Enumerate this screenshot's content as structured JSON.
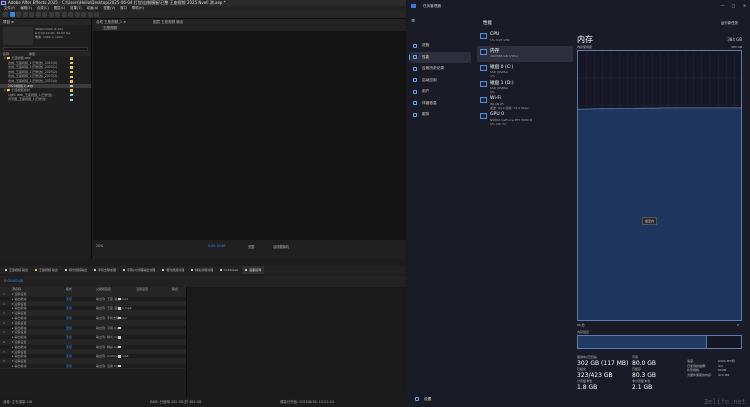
{
  "ae": {
    "title": "Adobe After Effects 2025 - C:\\Users\\Hello\\Desktop\\2025-06-04 打包\\自制模板\\已整 王座视频 2025 Nvell 测.aep *",
    "menu": [
      "文件(F)",
      "编辑(E)",
      "合成(C)",
      "图层(L)",
      "效果(T)",
      "动画(A)",
      "视图(V)",
      "窗口",
      "帮助(H)"
    ],
    "project_panel": {
      "tab": "项目 ≡",
      "thumb_info": "3840×2160 (1.00)\nΔ 0:00:10:00, 30.00 fps\n像素: 1080 × 1920",
      "columns": [
        "名称",
        "类型"
      ],
      "rows": [
        {
          "label": "▾ 📁 王座视频.aep",
          "kind": "folder",
          "color": "#e8c34a"
        },
        {
          "label": "合成_王座视频_1(已修改)_2025(0)",
          "kind": "item",
          "color": "#e8c34a"
        },
        {
          "label": "合成_王座视频_1(已修改)_2025(1)",
          "kind": "item",
          "color": "#e8c34a"
        },
        {
          "label": "合成_王座视频_1(已修改)_2025(2)",
          "kind": "item",
          "color": "#e8c34a"
        },
        {
          "label": "合成_王座视频_1(已修改)_2025(3)",
          "kind": "item",
          "color": "#e8c34a"
        },
        {
          "label": "合成_王座视频_1(已修改)_2025(4)",
          "kind": "item",
          "color": "#e8c34a"
        },
        {
          "label": "2025视频(1).aep",
          "kind": "item sel",
          "color": "#c8c8c8"
        },
        {
          "label": "▾ 📁 王座视频素材",
          "kind": "folder",
          "color": "#e8c34a"
        },
        {
          "label": "Light leak_王座视频_1(已修改)",
          "kind": "item",
          "color": "#8ad0e8"
        },
        {
          "label": "背景图_王座视频_1(已修改)",
          "kind": "item",
          "color": "#8ad0e8"
        }
      ]
    },
    "comp_panel": {
      "tab": "合成 王座视频_1 ≡",
      "tab2": "图层 王座视频 输出",
      "sub_tab": "王座视频",
      "zoom": "25%",
      "timecode": "0:00:10:00",
      "quality": "完整",
      "camera": "活动摄像机"
    },
    "timeline_tabs": [
      {
        "label": "王座视频 输出",
        "color": "#c8c8c8"
      },
      {
        "label": "王座视频 输出",
        "color": "#e8c34a"
      },
      {
        "label": "暗光视频输出",
        "color": "#c8c8c8"
      },
      {
        "label": "手机去除处理",
        "color": "#c8c8c8"
      },
      {
        "label": "字幕(2)处理输出处理",
        "color": "#c8c8c8"
      },
      {
        "label": "暗光视频处理",
        "color": "#c8c8c8"
      },
      {
        "label": "精彩剪辑处理",
        "color": "#c8c8c8"
      },
      {
        "label": "Outbreak",
        "color": "#c8c8c8"
      },
      {
        "label": "渲染队列",
        "color": "#c8c8c8"
      }
    ],
    "timeline": {
      "timecode": "0:00:00:00",
      "columns": [
        "源名称",
        "模式",
        "父级和链接",
        "渲染设置",
        "输出"
      ],
      "rows": [
        {
          "num": "1",
          "name": "▾ 渲染设置",
          "val": "",
          "src": "",
          "color": "",
          "lay": true
        },
        {
          "num": "",
          "name": "▸ 输出模块",
          "val": "无损",
          "src": "输出到: 王座_输出.mp4",
          "color": "#c8c8c8",
          "lay": false
        },
        {
          "num": "2",
          "name": "▾ 渲染设置",
          "val": "",
          "src": "",
          "color": "",
          "lay": true
        },
        {
          "num": "",
          "name": "▸ 输出模块",
          "val": "无损",
          "src": "输出到: 王座_输出_2.mp4",
          "color": "#c8c8c8",
          "lay": false
        },
        {
          "num": "3",
          "name": "▾ 渲染设置",
          "val": "",
          "src": "",
          "color": "",
          "lay": true
        },
        {
          "num": "",
          "name": "▸ 输出模块",
          "val": "无损",
          "src": "输出到: 手机去除.mp4",
          "color": "#c8c8c8",
          "lay": false
        },
        {
          "num": "4",
          "name": "▾ 渲染设置",
          "val": "",
          "src": "",
          "color": "",
          "lay": true
        },
        {
          "num": "",
          "name": "▸ 输出模块",
          "val": "无损",
          "src": "输出到: 字幕.mp4",
          "color": "#c8c8c8",
          "lay": false
        },
        {
          "num": "5",
          "name": "▾ 渲染设置",
          "val": "",
          "src": "",
          "color": "",
          "lay": true
        },
        {
          "num": "",
          "name": "▸ 输出模块",
          "val": "无损",
          "src": "输出到: 暗光.mp4",
          "color": "#c8c8c8",
          "lay": false
        },
        {
          "num": "6",
          "name": "▾ 渲染设置",
          "val": "",
          "src": "",
          "color": "",
          "lay": true
        },
        {
          "num": "",
          "name": "▸ 输出模块",
          "val": "无损",
          "src": "输出到: 精彩.mp4",
          "color": "#c8c8c8",
          "lay": false
        },
        {
          "num": "7",
          "name": "▾ 渲染设置",
          "val": "",
          "src": "",
          "color": "",
          "lay": true
        },
        {
          "num": "",
          "name": "▸ 输出模块",
          "val": "无损",
          "src": "输出到: Outbreak.mp4",
          "color": "#c8c8c8",
          "lay": false
        },
        {
          "num": "8",
          "name": "▾ 渲染设置",
          "val": "",
          "src": "",
          "color": "",
          "lay": true
        },
        {
          "num": "",
          "name": "▸ 输出模块",
          "val": "无损",
          "src": "输出到: 渲染.mp4",
          "color": "#c8c8c8",
          "lay": false
        }
      ]
    },
    "status": {
      "left": "消息: 正在渲染 1/8",
      "mid": "RAM: 已使用 302 GB 的 384 GB",
      "right": "渲染已开始: 2025/6/16, 13:22:24"
    }
  },
  "tm": {
    "title": "任务管理器",
    "window_controls": [
      "—",
      "□",
      "✕"
    ],
    "nav": [
      {
        "label": "进程",
        "icon": "grid-icon",
        "active": false
      },
      {
        "label": "性能",
        "icon": "chart-icon",
        "active": true
      },
      {
        "label": "应用历史记录",
        "icon": "history-icon",
        "active": false
      },
      {
        "label": "启动应用",
        "icon": "rocket-icon",
        "active": false
      },
      {
        "label": "用户",
        "icon": "users-icon",
        "active": false
      },
      {
        "label": "详细信息",
        "icon": "list-icon",
        "active": false
      },
      {
        "label": "服务",
        "icon": "puzzle-icon",
        "active": false
      }
    ],
    "settings": "设置",
    "heading": "性能",
    "run_task": "运行新任务",
    "devices": [
      {
        "name": "CPU",
        "sub1": "1%  3.07 GHz",
        "sub2": "",
        "active": false
      },
      {
        "name": "内存",
        "sub1": "302/383 GB (79%)",
        "sub2": "",
        "active": true
      },
      {
        "name": "磁盘 0 (C:)",
        "sub1": "SSD (NVMe)",
        "sub2": "1%",
        "active": false
      },
      {
        "name": "磁盘 1 (D:)",
        "sub1": "SSD (NVMe)",
        "sub2": "0%",
        "active": false
      },
      {
        "name": "Wi-Fi",
        "sub1": "WLAN 25",
        "sub2": "发送: 64.0 接收: 72.0 Kbps",
        "active": false
      },
      {
        "name": "GPU 0",
        "sub1": "NVIDIA GeForce RTX 5080 D",
        "sub2": "0% (36 °C)",
        "active": false
      }
    ],
    "memory": {
      "title": "内存",
      "total": "384 GB",
      "usage_label": "内存使用量",
      "max_label": "383 GB",
      "time_label": "60 秒",
      "zero": "0",
      "composition_label": "内存组合",
      "composition_fraction": 0.79,
      "tooltip": "最近内",
      "usage_series": [
        0.785,
        0.786,
        0.787,
        0.787,
        0.788,
        0.788,
        0.789,
        0.789,
        0.79,
        0.79,
        0.79,
        0.79,
        0.79,
        0.79,
        0.79,
        0.79
      ],
      "stats": [
        {
          "label": "使用中(已压缩)",
          "value": "302 GB (117 MB)"
        },
        {
          "label": "可用",
          "value": "80.0 GB"
        },
        {
          "label": "已提交",
          "value": "323/423 GB"
        },
        {
          "label": "已缓存",
          "value": "80.3 GB"
        },
        {
          "label": "分页缓冲池",
          "value": "1.8 GB"
        },
        {
          "label": "非分页缓冲池",
          "value": "2.1 GB"
        }
      ],
      "spec": [
        {
          "k": "速度:",
          "v": "6400 MT/秒"
        },
        {
          "k": "已使用的插槽:",
          "v": "4/4"
        },
        {
          "k": "外形规格:",
          "v": "DIMM"
        },
        {
          "k": "为硬件保留的内存:",
          "v": "470 MB"
        }
      ]
    },
    "watermark": "3elife.net"
  },
  "colors": {
    "accent": "#2d8ceb",
    "graph_fill": "#1e355d",
    "graph_line": "#5a7ab0",
    "tm_bg": "#191b26"
  }
}
